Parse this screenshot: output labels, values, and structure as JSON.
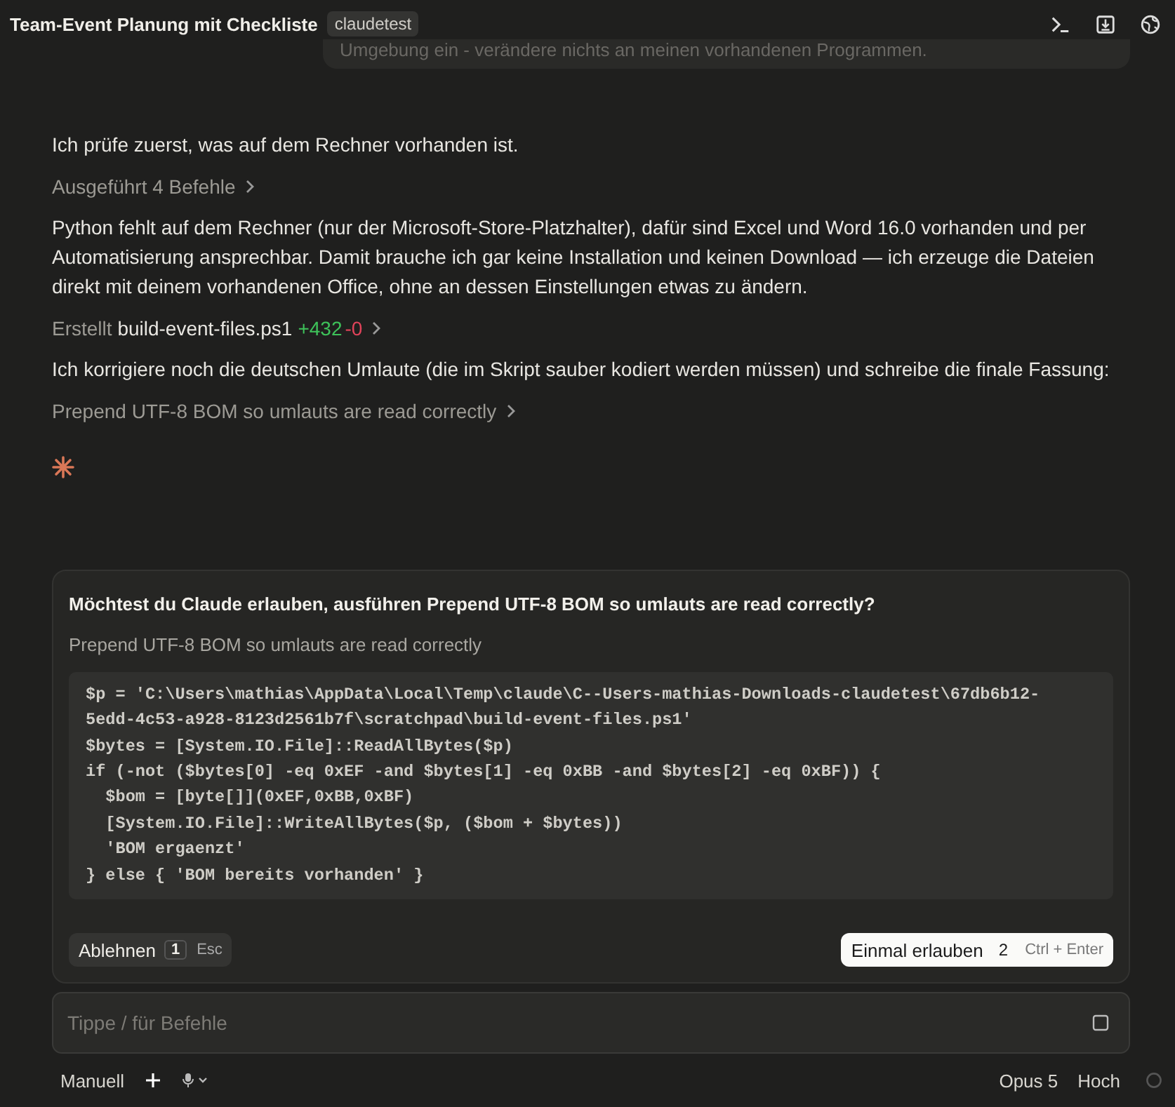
{
  "header": {
    "title": "Team-Event Planung mit Checkliste",
    "badge": "claudetest"
  },
  "user_message": "Umgebung ein - verändere nichts an meinen vorhandenen Programmen.",
  "messages": [
    {
      "kind": "text",
      "text": "Ich prüfe zuerst, was auf dem Rechner vorhanden ist."
    },
    {
      "kind": "action",
      "text": "Ausgeführt 4 Befehle"
    },
    {
      "kind": "text",
      "text": "Python fehlt auf dem Rechner (nur der Microsoft-Store-Platzhalter), dafür sind Excel und Word 16.0 vorhanden und per Automatisierung ansprechbar. Damit brauche ich gar keine Installation und keinen Download — ich erzeuge die Dateien direkt mit deinem vorhandenen Office, ohne an dessen Einstellungen etwas zu ändern."
    },
    {
      "kind": "file",
      "verb": "Erstellt",
      "file": "build-event-files.ps1",
      "added": "+432",
      "removed": "-0"
    },
    {
      "kind": "text",
      "text": "Ich korrigiere noch die deutschen Umlaute (die im Skript sauber kodiert werden müssen) und schreibe die finale Fassung:"
    },
    {
      "kind": "action",
      "text": "Prepend UTF-8 BOM so umlauts are read correctly"
    }
  ],
  "permission": {
    "question": "Möchtest du Claude erlauben, ausführen Prepend UTF-8 BOM so umlauts are read correctly?",
    "description": "Prepend UTF-8 BOM so umlauts are read correctly",
    "code": [
      "$p = 'C:\\Users\\mathias\\AppData\\Local\\Temp\\claude\\C--Users-mathias-Downloads-claudetest\\67db6b12-",
      "5edd-4c53-a928-8123d2561b7f\\scratchpad\\build-event-files.ps1'",
      "$bytes = [System.IO.File]::ReadAllBytes($p)",
      "if (-not ($bytes[0] -eq 0xEF -and $bytes[1] -eq 0xBB -and $bytes[2] -eq 0xBF)) {",
      "  $bom = [byte[]](0xEF,0xBB,0xBF)",
      "  [System.IO.File]::WriteAllBytes($p, ($bom + $bytes))",
      "  'BOM ergaenzt'",
      "} else { 'BOM bereits vorhanden' }"
    ],
    "deny": {
      "label": "Ablehnen",
      "key": "1",
      "shortcut": "Esc"
    },
    "allow": {
      "label": "Einmal erlauben",
      "key": "2",
      "shortcut": "Ctrl + Enter"
    }
  },
  "input": {
    "placeholder": "Tippe / für Befehle"
  },
  "footer": {
    "mode": "Manuell",
    "model": "Opus 5",
    "effort": "Hoch"
  }
}
